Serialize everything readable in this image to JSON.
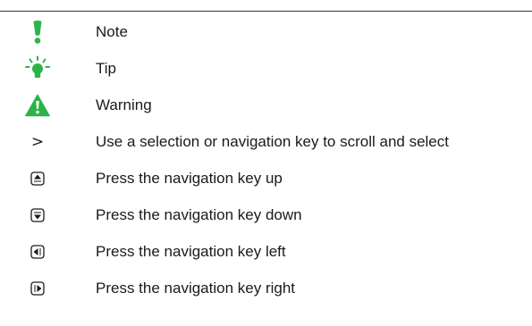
{
  "legend": {
    "rows": [
      {
        "icon": "note-icon",
        "label": "Note"
      },
      {
        "icon": "tip-icon",
        "label": "Tip"
      },
      {
        "icon": "warning-icon",
        "label": "Warning"
      },
      {
        "icon": "chevron-right-icon",
        "glyph": ">",
        "label": "Use a selection or navigation key to scroll and select"
      },
      {
        "icon": "nav-key-up-icon",
        "label": "Press the navigation key up"
      },
      {
        "icon": "nav-key-down-icon",
        "label": "Press the navigation key down"
      },
      {
        "icon": "nav-key-left-icon",
        "label": "Press the navigation key left"
      },
      {
        "icon": "nav-key-right-icon",
        "label": "Press the navigation key right"
      }
    ]
  },
  "colors": {
    "accent_green": "#2cb34a",
    "text": "#1a1a1a"
  }
}
